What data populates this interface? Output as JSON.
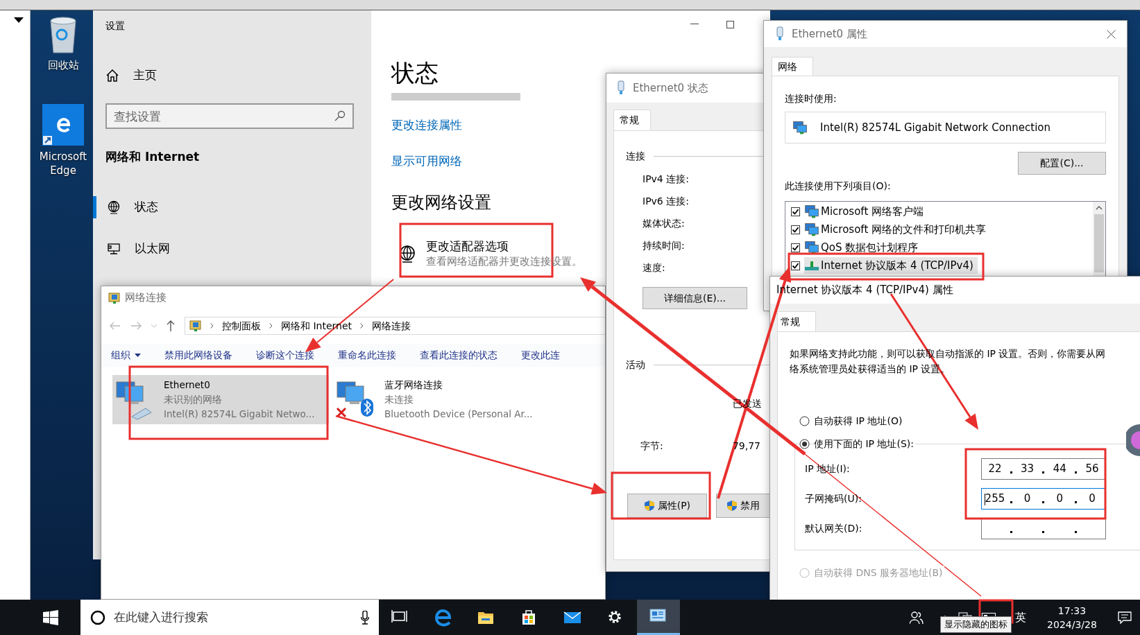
{
  "desktop": {
    "icons": [
      {
        "label": "回收站",
        "kind": "recycle"
      },
      {
        "label": "Microsoft Edge",
        "kind": "edge"
      }
    ]
  },
  "settings": {
    "app_title": "设置",
    "home": "主页",
    "search": {
      "placeholder": "查找设置"
    },
    "section": "网络和 Internet",
    "items": [
      {
        "label": "状态",
        "kind": "status",
        "selected": true
      },
      {
        "label": "以太网",
        "kind": "ethernet",
        "selected": false
      }
    ],
    "page_title": "状态",
    "links": [
      "更改连接属性",
      "显示可用网络"
    ],
    "subheading": "更改网络设置",
    "adapter_option": {
      "title": "更改适配器选项",
      "description": "查看网络适配器并更改连接设置。"
    }
  },
  "explorer": {
    "title": "网络连接",
    "breadcrumb": [
      "控制面板",
      "网络和 Internet",
      "网络连接"
    ],
    "toolbar": [
      {
        "label": "组织",
        "dropdown": true
      },
      {
        "label": "禁用此网络设备",
        "dropdown": false
      },
      {
        "label": "诊断这个连接",
        "dropdown": false
      },
      {
        "label": "重命名此连接",
        "dropdown": false
      },
      {
        "label": "查看此连接的状态",
        "dropdown": false
      },
      {
        "label": "更改此连",
        "dropdown": false
      }
    ],
    "connections": [
      {
        "name": "Ethernet0",
        "status": "未识别的网络",
        "device": "Intel(R) 82574L Gigabit Netwo...",
        "kind": "ethernet",
        "selected": true
      },
      {
        "name": "蓝牙网络连接",
        "status": "未连接",
        "device": "Bluetooth Device (Personal Ar...",
        "kind": "bluetooth",
        "selected": false
      }
    ]
  },
  "status_dialog": {
    "title": "Ethernet0 状态",
    "tabs": [
      {
        "label": "常规",
        "selected": true
      }
    ],
    "connection_group": "连接",
    "fields": [
      "IPv4 连接:",
      "IPv6 连接:",
      "媒体状态:",
      "持续时间:",
      "速度:"
    ],
    "details_button": "详细信息(E)...",
    "activity_group": "活动",
    "sent_label": "已发送",
    "bytes_label": "字节:",
    "bytes_sent": "79,77",
    "buttons": [
      "属性(P)",
      "禁用"
    ]
  },
  "properties_dialog": {
    "title": "Ethernet0 属性",
    "tabs": [
      {
        "label": "网络",
        "selected": true
      }
    ],
    "connect_using_label": "连接时使用:",
    "adapter": "Intel(R) 82574L Gigabit Network Connection",
    "configure_button": "配置(C)...",
    "items_label": "此连接使用下列项目(O):",
    "items": [
      {
        "label": "Microsoft 网络客户端",
        "checked": true,
        "selected": false
      },
      {
        "label": "Microsoft 网络的文件和打印机共享",
        "checked": true,
        "selected": false
      },
      {
        "label": "QoS 数据包计划程序",
        "checked": true,
        "selected": false
      },
      {
        "label": "Internet 协议版本 4 (TCP/IPv4)",
        "checked": true,
        "selected": true
      }
    ]
  },
  "ipv4_dialog": {
    "title": "Internet 协议版本 4 (TCP/IPv4) 属性",
    "tabs": [
      {
        "label": "常规",
        "selected": true
      }
    ],
    "description": "如果网络支持此功能，则可以获取自动指派的 IP 设置。否则，你需要从网络系统管理员处获得适当的 IP 设置。",
    "ip_mode": [
      {
        "label": "自动获得 IP 地址(O)",
        "selected": false
      },
      {
        "label": "使用下面的 IP 地址(S):",
        "selected": true
      }
    ],
    "fields": [
      {
        "label": "IP 地址(I):",
        "octets": [
          "22",
          "33",
          "44",
          "56"
        ],
        "focused": false
      },
      {
        "label": "子网掩码(U):",
        "octets": [
          "255",
          "0",
          "0",
          "0"
        ],
        "focused": true
      },
      {
        "label": "默认网关(D):",
        "focused": false
      }
    ],
    "dns_mode": [
      {
        "label": "自动获得 DNS 服务器地址(B)",
        "selected": false,
        "disabled": true
      }
    ]
  },
  "taskbar": {
    "search_placeholder": "在此键入进行搜索",
    "apps": [
      {
        "kind": "taskview",
        "active": false
      },
      {
        "kind": "edge",
        "active": false
      },
      {
        "kind": "folder",
        "active": false
      },
      {
        "kind": "store",
        "active": false
      },
      {
        "kind": "mail",
        "active": false
      },
      {
        "kind": "settings",
        "active": false
      },
      {
        "kind": "network",
        "active": true
      }
    ],
    "tooltip": "显示隐藏的图标",
    "ime": "英",
    "time": "17:33",
    "date": "2024/3/28"
  }
}
